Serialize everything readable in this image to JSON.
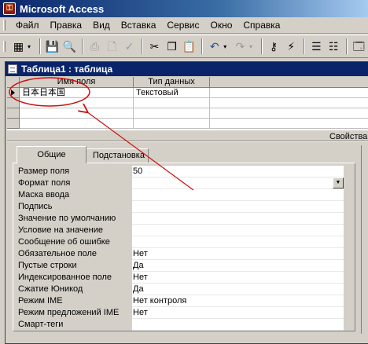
{
  "app": {
    "title": "Microsoft Access",
    "icon_name": "access-key-icon"
  },
  "menu": [
    "Файл",
    "Правка",
    "Вид",
    "Вставка",
    "Сервис",
    "Окно",
    "Справка"
  ],
  "window": {
    "title": "Таблица1 : таблица",
    "icon_name": "table-doc-icon"
  },
  "grid": {
    "columns": [
      "Имя поля",
      "Тип данных"
    ],
    "rows": [
      {
        "name": "日本日本国",
        "type": "Текстовый"
      }
    ]
  },
  "properties": {
    "label": "Свойства",
    "tabs": [
      "Общие",
      "Подстановка"
    ],
    "rows": [
      {
        "label": "Размер поля",
        "value": "50"
      },
      {
        "label": "Формат поля",
        "value": ""
      },
      {
        "label": "Маска ввода",
        "value": ""
      },
      {
        "label": "Подпись",
        "value": ""
      },
      {
        "label": "Значение по умолчанию",
        "value": ""
      },
      {
        "label": "Условие на значение",
        "value": ""
      },
      {
        "label": "Сообщение об ошибке",
        "value": ""
      },
      {
        "label": "Обязательное поле",
        "value": "Нет"
      },
      {
        "label": "Пустые строки",
        "value": "Да"
      },
      {
        "label": "Индексированное поле",
        "value": "Нет"
      },
      {
        "label": "Сжатие Юникод",
        "value": "Да"
      },
      {
        "label": "Режим IME",
        "value": "Нет контроля"
      },
      {
        "label": "Режим предложений IME",
        "value": "Нет"
      },
      {
        "label": "Смарт-теги",
        "value": ""
      }
    ]
  },
  "annotation_color": "#cc1010"
}
